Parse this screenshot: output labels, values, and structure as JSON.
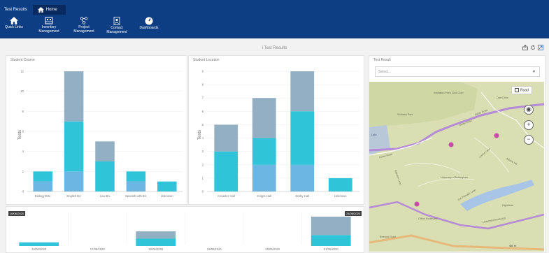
{
  "tabs": [
    {
      "label": "Test Results",
      "active": false
    },
    {
      "label": "Home",
      "active": true
    }
  ],
  "ribbon": [
    {
      "label": "Quick Links",
      "icon": "home-icon"
    },
    {
      "label": "Inventory Management",
      "icon": "inventory-icon"
    },
    {
      "label": "Project Management",
      "icon": "project-icon"
    },
    {
      "label": "Contact Management",
      "icon": "contact-icon"
    },
    {
      "label": "Dashboards",
      "icon": "dashboard-icon"
    }
  ],
  "page": {
    "title": "i Test Results"
  },
  "colors": {
    "bar_dark": "#93afc3",
    "bar_mid": "#2fc4d8",
    "bar_light": "#6bb6e2",
    "topbar": "#0d3d83"
  },
  "panels": {
    "course": {
      "title": "Student Course",
      "ylabel": "Tests"
    },
    "location": {
      "title": "Student Location",
      "ylabel": "Tests"
    },
    "result": {
      "title": "Test Result",
      "select_placeholder": "Select...",
      "map_mode": "Road"
    }
  },
  "map": {
    "labels": [
      "Wollaton Park Golf Club",
      "Derby Road",
      "Lake",
      "University of Nottingham",
      "Beeston Lane",
      "Lenton Lane",
      "University Boulevard",
      "Clifton Boulevard",
      "Adams Hill",
      "Cut Through Lane",
      "Highfields",
      "Beeston Road",
      "Abbey Road",
      "Derby Road",
      "Wollaton Park",
      "Dale Drive"
    ],
    "scale": "400 m"
  },
  "timeline": {
    "start_label": "16/06/2020",
    "end_label": "21/06/2020",
    "dates": [
      "16/06/2020",
      "17/06/2020",
      "18/06/2020",
      "19/06/2020",
      "20/06/2020",
      "21/06/2020"
    ]
  },
  "chart_data": [
    {
      "type": "bar",
      "title": "Student Course",
      "ylabel": "Tests",
      "ylim": [
        0,
        12
      ],
      "yticks": [
        0,
        2,
        4,
        6,
        8,
        10,
        12
      ],
      "categories": [
        "Biology BSc",
        "English BA",
        "Law BA",
        "Spanish with BA",
        "Unknown"
      ],
      "series": [
        {
          "values": [
            1,
            2,
            0,
            1,
            0
          ]
        },
        {
          "values": [
            1,
            5,
            3,
            1,
            1
          ]
        },
        {
          "values": [
            0,
            5,
            2,
            0,
            0
          ]
        }
      ]
    },
    {
      "type": "bar",
      "title": "Student Location",
      "ylabel": "Tests",
      "ylim": [
        0,
        9
      ],
      "yticks": [
        0,
        1,
        2,
        3,
        4,
        5,
        6,
        7,
        8,
        9
      ],
      "categories": [
        "Ancaster Hall",
        "Cripps Hall",
        "Derby Hall",
        "Unknown"
      ],
      "series": [
        {
          "values": [
            0,
            2,
            2,
            0
          ]
        },
        {
          "values": [
            3,
            2,
            4,
            1
          ]
        },
        {
          "values": [
            2,
            3,
            3,
            0
          ]
        }
      ]
    },
    {
      "type": "bar",
      "title": "",
      "categories": [
        "16/06/2020",
        "17/06/2020",
        "18/06/2020",
        "19/06/2020",
        "20/06/2020",
        "21/06/2020"
      ],
      "series": [
        {
          "values": [
            0,
            0,
            0,
            0,
            0,
            0
          ]
        },
        {
          "values": [
            1,
            0,
            2,
            0,
            0,
            3
          ]
        },
        {
          "values": [
            0,
            0,
            2,
            0,
            0,
            5
          ]
        }
      ]
    }
  ]
}
